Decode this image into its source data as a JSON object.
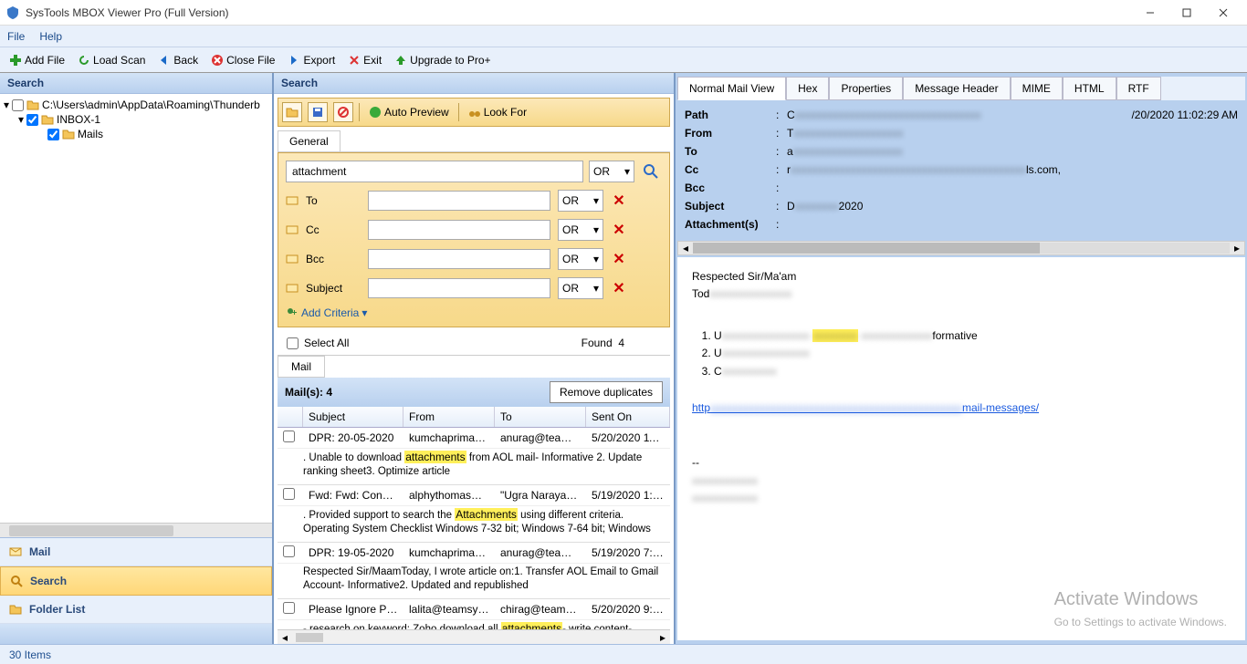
{
  "app": {
    "title": "SysTools MBOX Viewer Pro (Full Version)"
  },
  "menu": {
    "file": "File",
    "help": "Help"
  },
  "toolbar": {
    "add_file": "Add File",
    "load_scan": "Load Scan",
    "back": "Back",
    "close_file": "Close File",
    "export": "Export",
    "exit": "Exit",
    "upgrade": "Upgrade to Pro+"
  },
  "left": {
    "header": "Search",
    "tree": {
      "root": "C:\\Users\\admin\\AppData\\Roaming\\Thunderb",
      "inbox": "INBOX-1",
      "mails": "Mails"
    },
    "nav": {
      "mail": "Mail",
      "search": "Search",
      "folder_list": "Folder List"
    }
  },
  "mid": {
    "header": "Search",
    "tools": {
      "auto_preview": "Auto Preview",
      "look_for": "Look For"
    },
    "tab_general": "General",
    "keyword": "attachment",
    "op": "OR",
    "criteria": {
      "to": "To",
      "cc": "Cc",
      "bcc": "Bcc",
      "subject": "Subject"
    },
    "add_criteria": "Add Criteria",
    "select_all": "Select All",
    "found_label": "Found",
    "found_count": "4",
    "mail_tab": "Mail",
    "mails_label": "Mail(s):  4",
    "remove_dup": "Remove duplicates",
    "columns": {
      "subject": "Subject",
      "from": "From",
      "to": "To",
      "sent": "Sent On"
    },
    "results": [
      {
        "subject": "DPR: 20-05-2020",
        "from": "kumchapriman@...",
        "to": "anurag@teamsyst...",
        "sent": "5/20/2020 11:02...",
        "snippet_pre": ". Unable to download ",
        "snippet_hl": "attachments",
        "snippet_post": " from AOL mail- Informative 2. Update ranking sheet3. Optimize article"
      },
      {
        "subject": "Fwd: Fwd: Congr...",
        "from": "alphythomas@te...",
        "to": "\"Ugra Narayan P...",
        "sent": "5/19/2020 1:15:...",
        "snippet_pre": ". Provided support to search the ",
        "snippet_hl": "Attachments",
        "snippet_post": " using different criteria. Operating System Checklist     Windows 7-32 bit; Windows 7-64 bit; Windows"
      },
      {
        "subject": "DPR: 19-05-2020",
        "from": "kumchapriman@...",
        "to": "anurag@teamsyst...",
        "sent": "5/19/2020 7:56:...",
        "snippet_pre": "Respected Sir/MaamToday, I wrote article on:1. Transfer AOL Email to Gmail Account- Informative2. Updated and republished",
        "snippet_hl": "",
        "snippet_post": ""
      },
      {
        "subject": "Please Ignore Pr...",
        "from": "lalita@teamsysto...",
        "to": "chirag@teamsyst...",
        "sent": "5/20/2020 9:36:...",
        "snippet_pre": "- research on keyword: Zoho download all ",
        "snippet_hl": "attachments",
        "snippet_post": "- write content- publish"
      }
    ]
  },
  "right": {
    "tabs": {
      "normal": "Normal Mail View",
      "hex": "Hex",
      "props": "Properties",
      "msg_header": "Message Header",
      "mime": "MIME",
      "html": "HTML",
      "rtf": "RTF"
    },
    "headers": {
      "path_k": "Path",
      "path_v": "C",
      "path_date": "/20/2020 11:02:29 AM",
      "from_k": "From",
      "from_v": "T",
      "to_k": "To",
      "to_v": "a",
      "cc_k": "Cc",
      "cc_v": "r",
      "cc_tail": "ls.com,",
      "bcc_k": "Bcc",
      "subject_k": "Subject",
      "subject_v": "D",
      "subject_tail": "2020",
      "attach_k": "Attachment(s)"
    },
    "body": {
      "greeting": "Respected Sir/Ma'am",
      "today": "Tod",
      "li1_pre": "U",
      "li1_tail": "formative",
      "li2": "U",
      "li3": "C",
      "link_pre": "http",
      "link_tail": "mail-messages/",
      "sig_dash": "--"
    },
    "watermark": {
      "l1": "Activate Windows",
      "l2": "Go to Settings to activate Windows."
    }
  },
  "status": {
    "items": "30 Items"
  }
}
